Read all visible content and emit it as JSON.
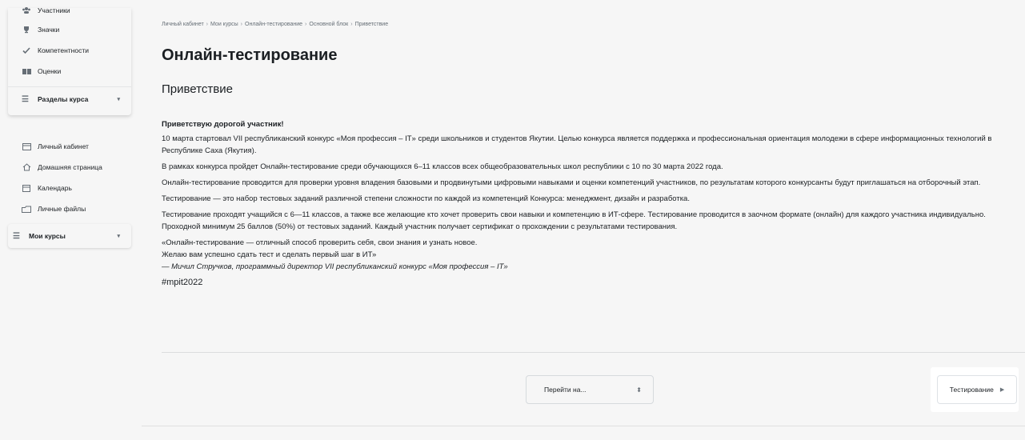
{
  "sidebar": {
    "course_menu": [
      {
        "label": "Участники",
        "icon": "users-icon"
      },
      {
        "label": "Значки",
        "icon": "trophy-icon"
      },
      {
        "label": "Компетентности",
        "icon": "check-icon"
      },
      {
        "label": "Оценки",
        "icon": "grades-icon"
      }
    ],
    "sections_label": "Разделы курса",
    "nav": [
      {
        "label": "Личный кабинет",
        "icon": "dashboard-icon"
      },
      {
        "label": "Домашняя страница",
        "icon": "home-icon"
      },
      {
        "label": "Календарь",
        "icon": "calendar-icon"
      },
      {
        "label": "Личные файлы",
        "icon": "files-icon"
      }
    ],
    "my_courses_label": "Мои курсы"
  },
  "breadcrumb": [
    "Личный кабинет",
    "Мои курсы",
    "Онлайн-тестирование",
    "Основной блок",
    "Приветствие"
  ],
  "page_title": "Онлайн-тестирование",
  "section_title": "Приветствие",
  "content": {
    "greeting": "Приветствую дорогой участник!",
    "p1": "10 марта стартовал VII республиканский конкурс «Моя профессия – IT» среди школьников и студентов Якутии. Целью конкурса является поддержка и профессиональная ориентация молодежи в сфере информационных технологий в Республике Саха (Якутия).",
    "p2": "В рамках конкурса пройдет Онлайн-тестирование среди обучающихся 6–11 классов всех общеобразовательных школ республики с 10 по 30 марта 2022 года.",
    "p3": "Онлайн-тестирование проводится для проверки уровня владения базовыми и продвинутыми цифровыми навыками и оценки компетенций участников, по результатам которого конкурсанты будут приглашаться на отборочный этап.",
    "p4": "Тестирование — это набор тестовых заданий различной степени сложности по каждой из компетенций Конкурса: менеджмент, дизайн и разработка.",
    "p5": "Тестирование проходят учащийся с 6—11 классов, а также все желающие кто хочет проверить свои навыки и компетенцию в ИТ-сфере. Тестирование проводится в заочном формате (онлайн) для каждого участника индивидуально. Проходной минимум 25 баллов (50%) от тестовых заданий. Каждый участник получает сертификат о прохождении с результатами тестирования.",
    "quote1": "«Онлайн-тестирование — отличный способ проверить себя, свои знания и узнать новое.",
    "quote2": "Желаю вам успешно сдать тест и сделать первый шаг в ИТ»",
    "author": "— Мичил Стручков, программный директор VII республиканский конкурс «Моя профессия – IT»",
    "hashtag": "#mpit2022"
  },
  "jump_to": {
    "label": "Перейти на..."
  },
  "next_activity": {
    "label": "Тестирование"
  }
}
